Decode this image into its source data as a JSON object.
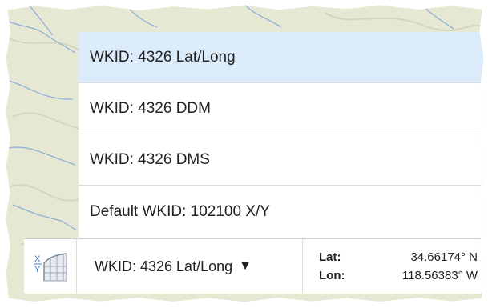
{
  "dropdown": {
    "options": [
      {
        "label": "WKID: 4326 Lat/Long",
        "selected": true
      },
      {
        "label": "WKID: 4326 DDM",
        "selected": false
      },
      {
        "label": "WKID: 4326 DMS",
        "selected": false
      },
      {
        "label": "Default WKID: 102100 X/Y",
        "selected": false
      }
    ]
  },
  "toolbar": {
    "xy_icon": "xy-coordinate-icon",
    "current_wkid": "WKID: 4326 Lat/Long",
    "dropdown_arrow": "▼"
  },
  "coords": {
    "lat_label": "Lat:",
    "lat_value": "34.66174° N",
    "lon_label": "Lon:",
    "lon_value": "118.56383° W"
  },
  "colors": {
    "selected_option_bg": "#dcebfa",
    "map_terrain": "#e9ead8",
    "water_lines": "#8fb0d8"
  }
}
